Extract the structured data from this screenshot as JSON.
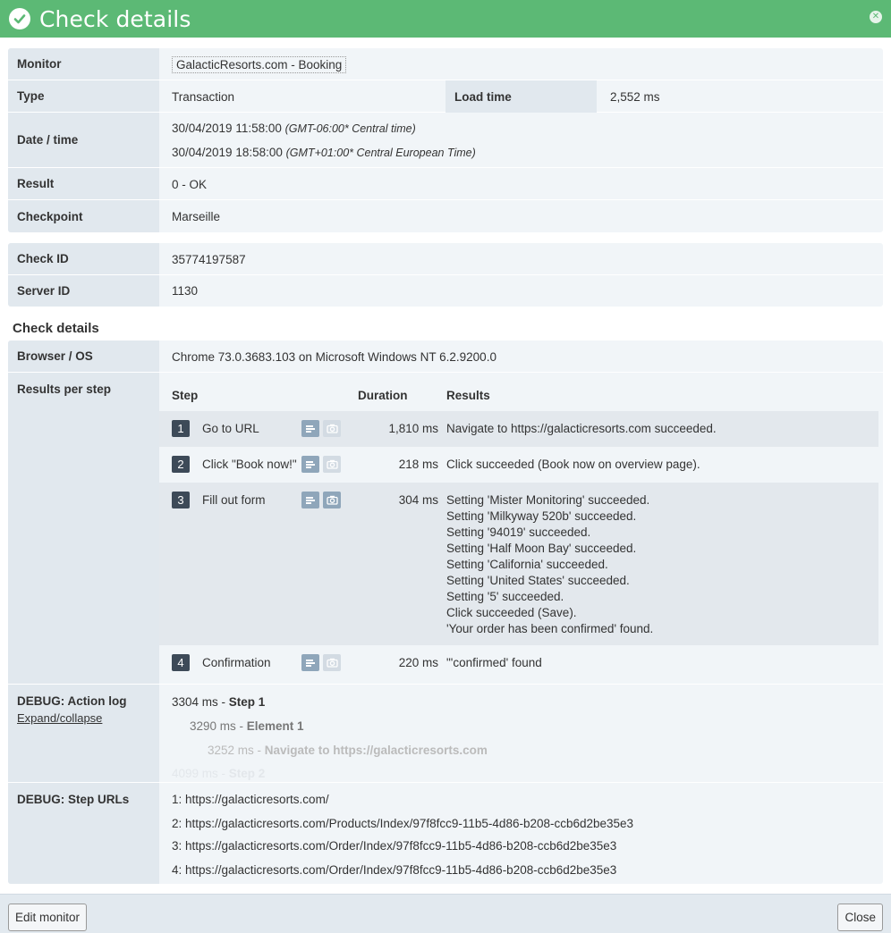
{
  "header": {
    "title": "Check details"
  },
  "info": {
    "monitor_label": "Monitor",
    "monitor_value": "GalacticResorts.com - Booking",
    "type_label": "Type",
    "type_value": "Transaction",
    "load_label": "Load time",
    "load_value": "2,552 ms",
    "date_label": "Date / time",
    "date1": "30/04/2019 11:58:00",
    "date1_tz": "(GMT-06:00* Central time)",
    "date2": "30/04/2019 18:58:00",
    "date2_tz": "(GMT+01:00* Central European Time)",
    "result_label": "Result",
    "result_value": "0 - OK",
    "checkpoint_label": "Checkpoint",
    "checkpoint_value": "Marseille"
  },
  "ids": {
    "check_label": "Check ID",
    "check_value": "35774197587",
    "server_label": "Server ID",
    "server_value": "1130"
  },
  "details": {
    "section_title": "Check details",
    "browser_label": "Browser / OS",
    "browser_value": "Chrome 73.0.3683.103 on Microsoft Windows NT 6.2.9200.0",
    "steps_label": "Results per step",
    "col_step": "Step",
    "col_duration": "Duration",
    "col_results": "Results",
    "steps": [
      {
        "num": "1",
        "name": "Go to URL",
        "duration": "1,810 ms",
        "results": "Navigate to https://galacticresorts.com succeeded."
      },
      {
        "num": "2",
        "name": "Click \"Book now!\"",
        "duration": "218 ms",
        "results": "Click succeeded (Book now on overview page)."
      },
      {
        "num": "3",
        "name": "Fill out form",
        "duration": "304 ms",
        "results": [
          "Setting 'Mister Monitoring' succeeded.",
          "Setting 'Milkyway 520b' succeeded.",
          "Setting '94019' succeeded.",
          "Setting 'Half Moon Bay' succeeded.",
          "Setting 'California' succeeded.",
          "Setting 'United States' succeeded.",
          "Setting '5' succeeded.",
          "Click succeeded (Save).",
          "'Your order has been confirmed' found."
        ]
      },
      {
        "num": "4",
        "name": "Confirmation",
        "duration": "220 ms",
        "results": "\"'confirmed' found"
      }
    ],
    "debug_label": "DEBUG: Action log",
    "expand_link": "Expand/collapse",
    "log": [
      {
        "time": "3304 ms",
        "sep": " - ",
        "text": "Step 1"
      },
      {
        "time": "3290 ms",
        "sep": " - ",
        "text": "Element 1"
      },
      {
        "time": "3252 ms",
        "sep": " - ",
        "text": "Navigate to https://galacticresorts.com"
      },
      {
        "time": "4099 ms",
        "sep": " - ",
        "text": "Step 2"
      }
    ],
    "urls_label": "DEBUG: Step URLs",
    "urls": [
      "1: https://galacticresorts.com/",
      "2: https://galacticresorts.com/Products/Index/97f8fcc9-11b5-4d86-b208-ccb6d2be35e3",
      "3: https://galacticresorts.com/Order/Index/97f8fcc9-11b5-4d86-b208-ccb6d2be35e3",
      "4: https://galacticresorts.com/Order/Index/97f8fcc9-11b5-4d86-b208-ccb6d2be35e3"
    ]
  },
  "footer": {
    "edit_label": "Edit monitor",
    "close_label": "Close"
  }
}
